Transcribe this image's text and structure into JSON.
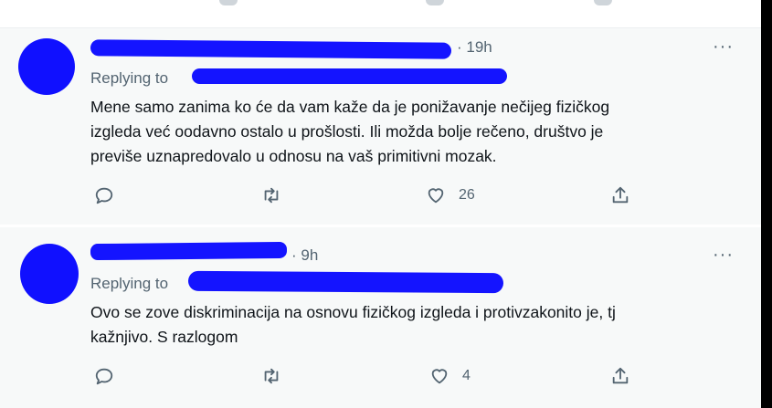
{
  "tweets": [
    {
      "time": "· 19h",
      "replying_label": "Replying to",
      "text_lines": [
        "Mene samo zanima ko će da vam kaže da je ponižavanje nečijeg fizičkog",
        "izgleda već oodavno ostalo u prošlosti. Ili možda bolje rečeno, društvo je",
        "previše uznapredovalo u odnosu na vaš primitivni mozak."
      ],
      "likes": "26",
      "more": "···"
    },
    {
      "time": "· 9h",
      "replying_label": "Replying to",
      "text_lines": [
        "Ovo se zove diskriminacija na osnovu fizičkog izgleda i protivzakonito je, tj",
        "kažnjivo. S razlogom"
      ],
      "likes": "4",
      "more": "···"
    }
  ],
  "icons": [
    "reply-icon",
    "retweet-icon",
    "like-icon",
    "share-icon",
    "more-icon"
  ],
  "colors": {
    "redaction": "#1414ff",
    "muted": "#536471",
    "text": "#0f1419",
    "card_bg": "#f7f9f9"
  }
}
